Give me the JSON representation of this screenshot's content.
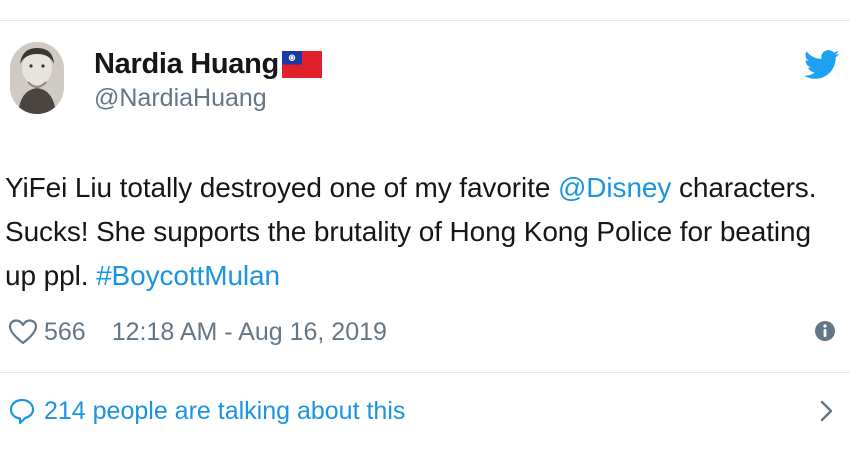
{
  "user": {
    "display_name": "Nardia Huang",
    "handle": "@NardiaHuang",
    "flag_icon": "taiwan-flag-icon",
    "avatar_icon": "profile-photo"
  },
  "platform_icon": "twitter-bird-icon",
  "tweet": {
    "segments": [
      "YiFei Liu totally destroyed one of my favorite ",
      "@Disney",
      " characters. Sucks! She supports the brutality of Hong Kong Police for beating up ppl. ",
      "#BoycottMulan"
    ]
  },
  "meta": {
    "like_count": "566",
    "timestamp": "12:18 AM - Aug 16, 2019"
  },
  "conversation": {
    "label": "214 people are talking about this"
  },
  "colors": {
    "link": "#1b95e0",
    "text": "#14171a",
    "muted": "#657786",
    "border": "#e1e8ed",
    "flag_red": "#e0202a",
    "flag_blue": "#1a3aa0"
  }
}
